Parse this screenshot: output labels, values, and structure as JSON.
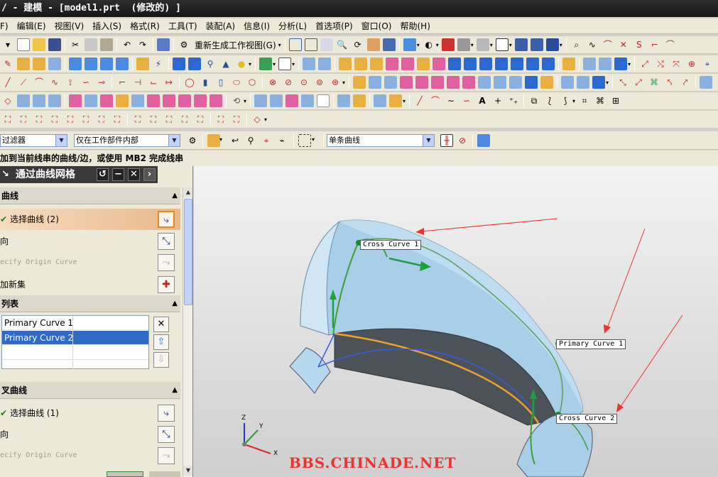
{
  "window": {
    "title": "/ - 建模 - [model1.prt  (修改的) ]"
  },
  "menubar": {
    "items": [
      "F)",
      "编辑(E)",
      "视图(V)",
      "插入(S)",
      "格式(R)",
      "工具(T)",
      "装配(A)",
      "信息(I)",
      "分析(L)",
      "首选项(P)",
      "窗口(O)",
      "帮助(H)"
    ]
  },
  "toolbar": {
    "regen_view_label": "重新生成工作视图(G)"
  },
  "filterbar": {
    "type_filter": "过滤器",
    "scope_filter": "仅在工作部件内部",
    "curve_rule": "单条曲线"
  },
  "cue": {
    "text": "加到当前线串的曲线/边，或使用 MB2 完成线串"
  },
  "dialog": {
    "title": "通过曲线网格",
    "primary_section": {
      "title": "曲线",
      "select_label": "选择曲线 (2)",
      "reverse_label": "向",
      "origin_label": "ecify Origin Curve",
      "add_set_label": "加新集"
    },
    "list_section": {
      "title": "列表",
      "items": [
        "Primary Curve  1",
        "Primary Curve  2"
      ],
      "selected_index": 1
    },
    "cross_section": {
      "title": "叉曲线",
      "select_label": "选择曲线 (1)",
      "reverse_label": "向",
      "origin_label": "ecify Origin Curve"
    }
  },
  "viewport": {
    "callouts": {
      "cross1": "Cross Curve  1",
      "primary1": "Primary Curve  1",
      "cross2": "Cross Curve  2"
    },
    "axes": {
      "x": "X",
      "y": "Y",
      "z": "Z"
    },
    "watermark": "BBS.CHINADE.NET"
  },
  "colors": {
    "surface": "#a9cfe8",
    "arrow": "#e8352f",
    "selection": "#316ac5",
    "highlight_orange": "#e9b88a"
  }
}
